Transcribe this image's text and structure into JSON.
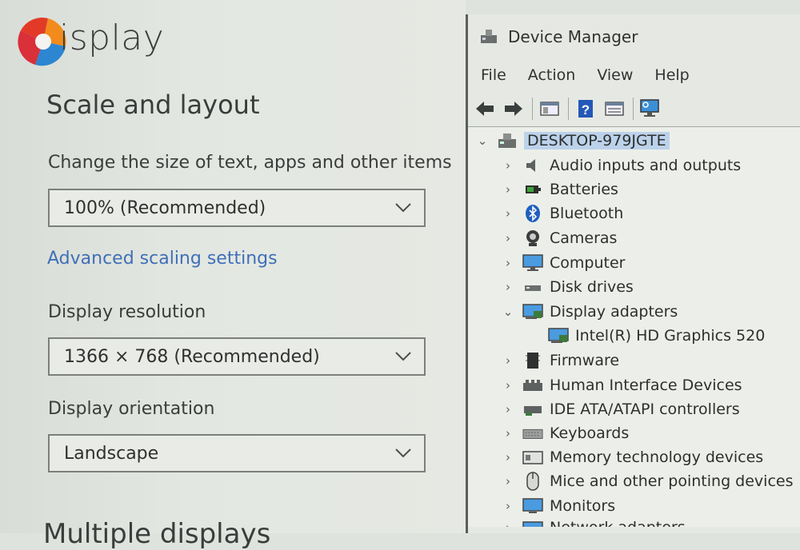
{
  "settings": {
    "page_title": "isplay",
    "section_title": "Scale and layout",
    "scale_label": "Change the size of text, apps and other items",
    "scale_value": "100% (Recommended)",
    "advanced_link": "Advanced scaling settings",
    "resolution_label": "Display resolution",
    "resolution_value": "1366 × 768 (Recommended)",
    "orientation_label": "Display orientation",
    "orientation_value": "Landscape",
    "cut_heading": "Multiple displays"
  },
  "device_manager": {
    "title": "Device Manager",
    "menu": [
      "File",
      "Action",
      "View",
      "Help"
    ],
    "root": "DESKTOP-979JGTE",
    "nodes": [
      {
        "label": "Audio inputs and outputs",
        "icon": "speaker-icon",
        "expanded": false
      },
      {
        "label": "Batteries",
        "icon": "battery-icon",
        "expanded": false
      },
      {
        "label": "Bluetooth",
        "icon": "bluetooth-icon",
        "expanded": false
      },
      {
        "label": "Cameras",
        "icon": "camera-icon",
        "expanded": false
      },
      {
        "label": "Computer",
        "icon": "monitor-icon",
        "expanded": false
      },
      {
        "label": "Disk drives",
        "icon": "disk-icon",
        "expanded": false
      },
      {
        "label": "Display adapters",
        "icon": "display-adapter-icon",
        "expanded": true
      },
      {
        "label": "Intel(R) HD Graphics 520",
        "icon": "display-adapter-icon",
        "child": true
      },
      {
        "label": "Firmware",
        "icon": "chip-icon",
        "expanded": false
      },
      {
        "label": "Human Interface Devices",
        "icon": "hid-icon",
        "expanded": false
      },
      {
        "label": "IDE ATA/ATAPI controllers",
        "icon": "controller-icon",
        "expanded": false
      },
      {
        "label": "Keyboards",
        "icon": "keyboard-icon",
        "expanded": false
      },
      {
        "label": "Memory technology devices",
        "icon": "memory-icon",
        "expanded": false
      },
      {
        "label": "Mice and other pointing devices",
        "icon": "mouse-icon",
        "expanded": false
      },
      {
        "label": "Monitors",
        "icon": "monitor-icon",
        "expanded": false
      },
      {
        "label": "Network adapters",
        "icon": "network-icon",
        "expanded": false
      }
    ]
  },
  "colors": {
    "link": "#3f6fb8",
    "selection": "#bcd2ea",
    "accent_blue": "#1f5fbf"
  }
}
